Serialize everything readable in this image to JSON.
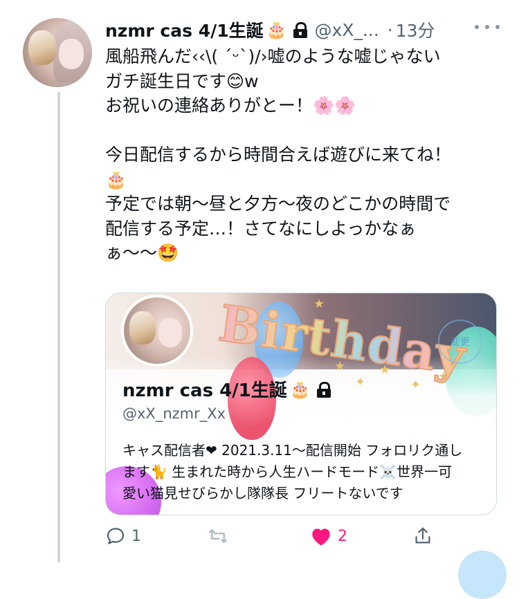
{
  "tweet": {
    "display_name": "nzmr cas 4/1生誕",
    "name_emoji": "🎂",
    "handle": "@xX_...",
    "separator": "·",
    "time": "13分",
    "lines": [
      "風船飛んだ‹‹\\( ´ᵕ`)/›嘘のような嘘じゃない",
      "ガチ誕生日です😊w",
      "お祝いの連絡ありがとー！🌸🌸",
      "",
      "今日配信するから時間合えば遊びに来てね！",
      "🎂",
      "予定では朝〜昼と夕方〜夜のどこかの時間で",
      "配信する予定…！さてなにしよっかなぁ",
      "ぁ〜〜🤩"
    ]
  },
  "card": {
    "banner_text": "Birthday",
    "follow_badge": "変更",
    "display_name": "nzmr cas 4/1生誕",
    "name_emoji": "🎂",
    "handle": "@xX_nzmr_Xx",
    "bio_lines": [
      "キャス配信者❤ 2021.3.11〜配信開始 フォロリク通し",
      "ます🐈 生まれた時から人生ハードモード☠️世界一可",
      "愛い猫見せびらかし隊隊長 フリートないです"
    ]
  },
  "actions": {
    "reply_count": "1",
    "retweet_count": "",
    "like_count": "2",
    "like_color": "#f91880"
  }
}
